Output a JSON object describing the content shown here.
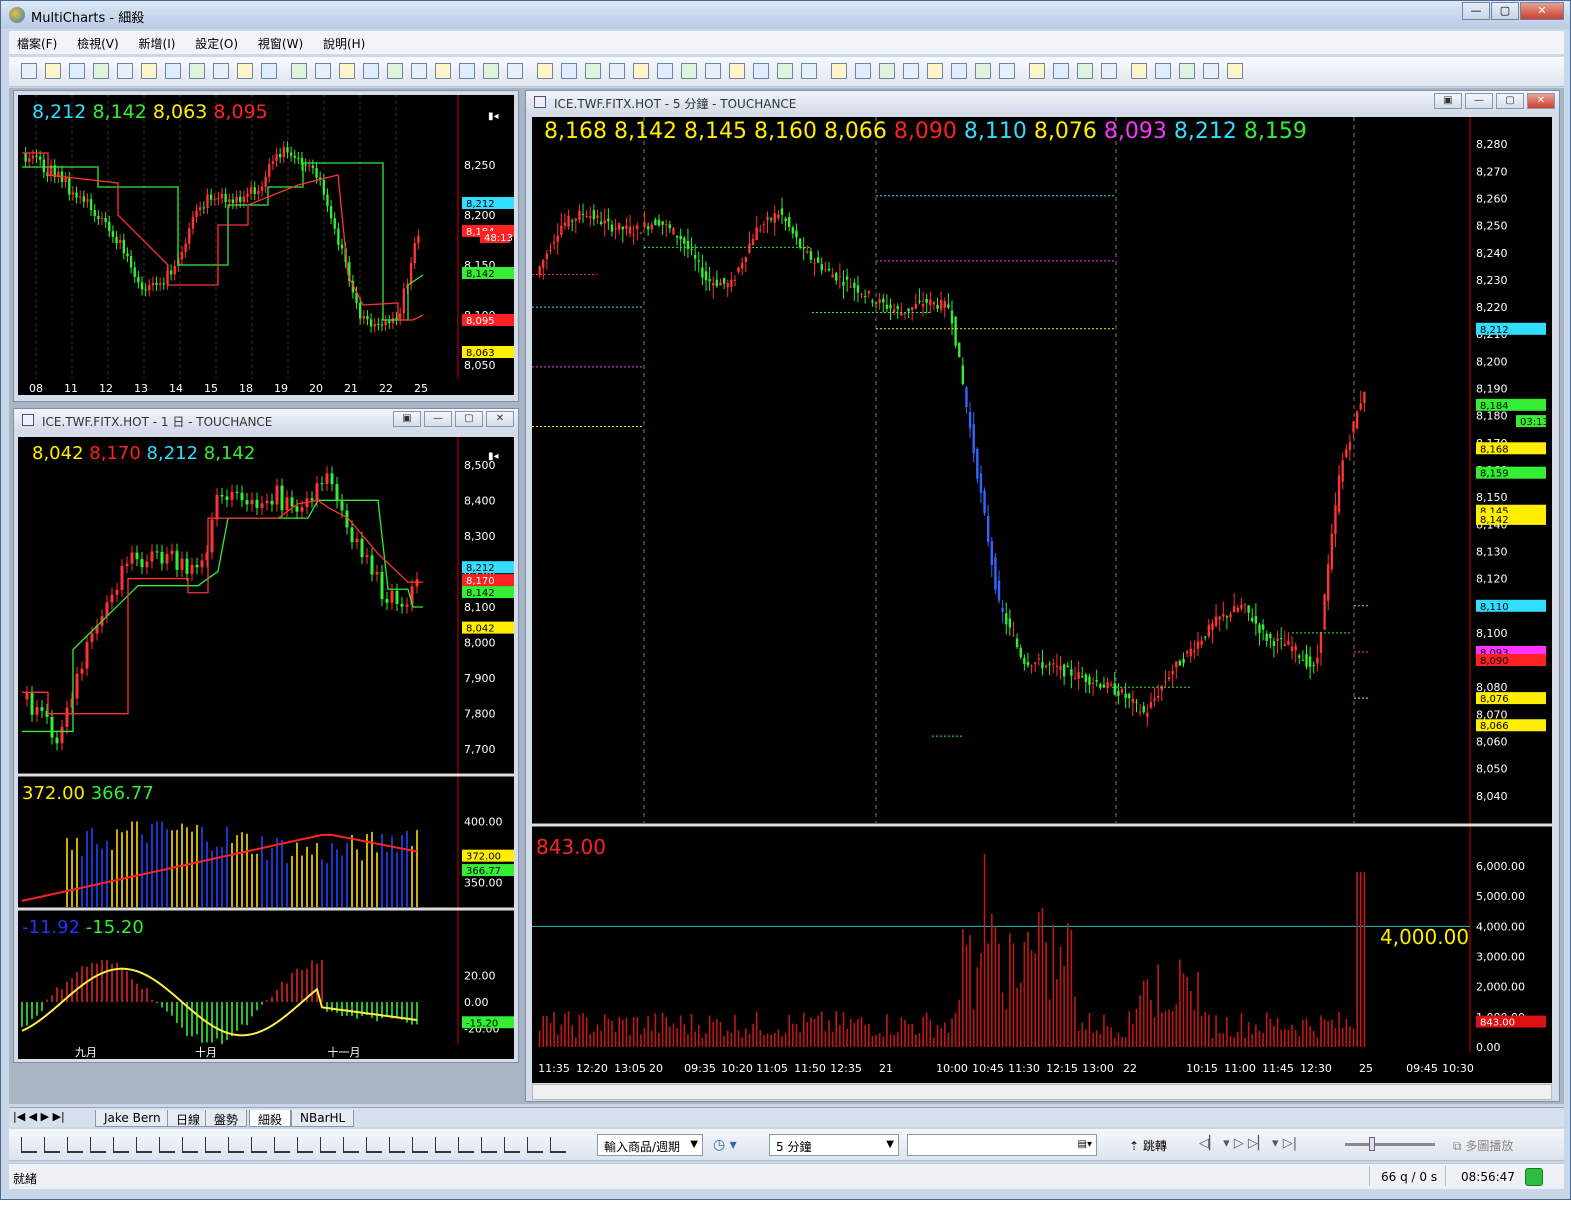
{
  "window": {
    "title": "MultiCharts - 細殺",
    "min": "—",
    "max": "▢",
    "close": "✕"
  },
  "menu": [
    "檔案(F)",
    "檢視(V)",
    "新增(I)",
    "設定(O)",
    "視窗(W)",
    "說明(H)"
  ],
  "chart_topleft": {
    "values": [
      {
        "text": "8,212",
        "color": "#33ddff"
      },
      {
        "text": "8,142",
        "color": "#33ee33"
      },
      {
        "text": "8,063",
        "color": "#ffee00"
      },
      {
        "text": "8,095",
        "color": "#ff2222"
      }
    ],
    "price_labels": [
      "8,250",
      "8,200",
      "8,150",
      "8,100",
      "8,050"
    ],
    "tags": [
      {
        "text": "8,212",
        "color": "#33ddff"
      },
      {
        "text": "8,184",
        "color": "#ff2222"
      },
      {
        "text": "48:13",
        "color": "#ff2222"
      },
      {
        "text": "8,142",
        "color": "#33ee33"
      },
      {
        "text": "8,095",
        "color": "#ff2222"
      },
      {
        "text": "8,063",
        "color": "#ffee00"
      }
    ],
    "x_labels": [
      "08",
      "11",
      "12",
      "13",
      "14",
      "15",
      "18",
      "19",
      "20",
      "21",
      "22",
      "25"
    ]
  },
  "chart_daily": {
    "title": "ICE.TWF.FITX.HOT - 1 日 - TOUCHANCE",
    "values": [
      {
        "text": "8,042",
        "color": "#ffee00"
      },
      {
        "text": "8,170",
        "color": "#ff2222"
      },
      {
        "text": "8,212",
        "color": "#33ddff"
      },
      {
        "text": "8,142",
        "color": "#33ee33"
      }
    ],
    "price_labels": [
      "8,500",
      "8,400",
      "8,300",
      "8,200",
      "8,100",
      "8,000",
      "7,900",
      "7,800",
      "7,700"
    ],
    "tags": [
      {
        "text": "8,212",
        "color": "#33ddff"
      },
      {
        "text": "8,170",
        "color": "#ff2222"
      },
      {
        "text": "8,142",
        "color": "#33ee33"
      },
      {
        "text": "8,042",
        "color": "#ffee00"
      }
    ],
    "sub1": {
      "values": [
        {
          "text": "372.00",
          "color": "#ffee00"
        },
        {
          "text": "366.77",
          "color": "#33ee33"
        }
      ],
      "labels": [
        "400.00",
        "350.00"
      ],
      "tags": [
        {
          "text": "372.00",
          "color": "#ffee00"
        },
        {
          "text": "366.77",
          "color": "#33ee33"
        }
      ]
    },
    "sub2": {
      "values": [
        {
          "text": "-11.92",
          "color": "#2233ff"
        },
        {
          "text": "-15.20",
          "color": "#33ee33"
        }
      ],
      "labels": [
        "20.00",
        "0.00",
        "-20.00"
      ],
      "tags": [
        {
          "text": "-15.20",
          "color": "#33ee33"
        }
      ]
    },
    "x_labels": [
      "九月",
      "十月",
      "十一月"
    ]
  },
  "chart_5min": {
    "title": "ICE.TWF.FITX.HOT - 5 分鐘 - TOUCHANCE",
    "values": [
      {
        "text": "8,168",
        "color": "#ffee00"
      },
      {
        "text": "8,142",
        "color": "#ffee00"
      },
      {
        "text": "8,145",
        "color": "#ffee00"
      },
      {
        "text": "8,160",
        "color": "#ffee00"
      },
      {
        "text": "8,066",
        "color": "#ffee00"
      },
      {
        "text": "8,090",
        "color": "#ff2222"
      },
      {
        "text": "8,110",
        "color": "#33ddff"
      },
      {
        "text": "8,076",
        "color": "#ffee00"
      },
      {
        "text": "8,093",
        "color": "#ff33ff"
      },
      {
        "text": "8,212",
        "color": "#33ddff"
      },
      {
        "text": "8,159",
        "color": "#33ee33"
      }
    ],
    "price_labels": [
      "8,280",
      "8,270",
      "8,260",
      "8,250",
      "8,240",
      "8,230",
      "8,220",
      "8,210",
      "8,200",
      "8,190",
      "8,180",
      "8,170",
      "8,160",
      "8,150",
      "8,140",
      "8,130",
      "8,120",
      "8,110",
      "8,100",
      "8,090",
      "8,080",
      "8,070",
      "8,060",
      "8,050",
      "8,040"
    ],
    "tags": [
      {
        "text": "8,212",
        "color": "#33ddff"
      },
      {
        "text": "8,184",
        "color": "#33ee33"
      },
      {
        "text": "03:13",
        "color": "#33ee33"
      },
      {
        "text": "8,168",
        "color": "#ffee00"
      },
      {
        "text": "8,159",
        "color": "#33ee33"
      },
      {
        "text": "8,145",
        "color": "#ffee00"
      },
      {
        "text": "8,142",
        "color": "#ffee00"
      },
      {
        "text": "8,110",
        "color": "#33ddff"
      },
      {
        "text": "8,093",
        "color": "#ff33ff"
      },
      {
        "text": "8,090",
        "color": "#ff2222"
      },
      {
        "text": "8,076",
        "color": "#ffee00"
      },
      {
        "text": "8,066",
        "color": "#ffee00"
      }
    ],
    "volume": {
      "value": {
        "text": "843.00",
        "color": "#ff2222"
      },
      "labels": [
        "6,000.00",
        "5,000.00",
        "4,000.00",
        "3,000.00",
        "2,000.00",
        "1,000.00",
        "0.00"
      ],
      "line_label": "4,000.00",
      "tag": "843.00"
    },
    "x_labels": [
      "11:35",
      "12:20",
      "13:05",
      "20",
      "09:35",
      "10:20",
      "11:05",
      "11:50",
      "12:35",
      "21",
      "10:00",
      "10:45",
      "11:30",
      "12:15",
      "13:00",
      "22",
      "10:15",
      "11:00",
      "11:45",
      "12:30",
      "25",
      "09:45",
      "10:30"
    ]
  },
  "tabs": [
    "Jake Bern",
    "日線",
    "盤勢",
    "細殺",
    "NBarHL"
  ],
  "drawbar": {
    "symbol_input": "輸入商品/週期",
    "interval": "5 分鐘",
    "jump": "跳轉",
    "multi": "多圖播放"
  },
  "status": {
    "ready": "就緒",
    "queue": "66 q / 0 s",
    "time": "08:56:47"
  },
  "chart_data": [
    {
      "type": "candlestick",
      "title": "",
      "ylim": [
        8040,
        8280
      ],
      "x_tick_labels": [
        "11:35",
        "12:20",
        "13:05",
        "20",
        "09:35",
        "10:20",
        "11:05",
        "11:50",
        "12:35",
        "21",
        "10:00",
        "10:45",
        "11:30",
        "12:15",
        "13:00",
        "22",
        "10:15",
        "11:00",
        "11:45",
        "12:30",
        "25",
        "09:45",
        "10:30"
      ],
      "last_values": [
        8168,
        8142,
        8145,
        8160,
        8066,
        8090,
        8110,
        8076,
        8093,
        8212,
        8159
      ],
      "path_y": [
        8232,
        8250,
        8255,
        8250,
        8248,
        8252,
        8245,
        8230,
        8228,
        8248,
        8255,
        8240,
        8233,
        8228,
        8222,
        8218,
        8222,
        8220,
        8165,
        8110,
        8090,
        8088,
        8085,
        8082,
        8078,
        8070,
        8085,
        8095,
        8105,
        8110,
        8098,
        8095,
        8086,
        8160,
        8190
      ]
    },
    {
      "type": "bar",
      "title": "",
      "ylim": [
        0,
        6500
      ],
      "reference_line": 4000,
      "last_value": 843
    }
  ]
}
